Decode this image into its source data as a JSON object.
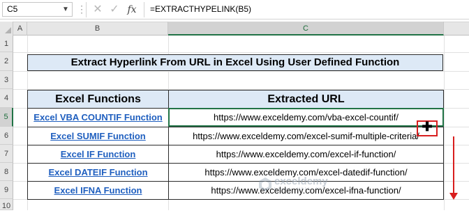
{
  "formula_bar": {
    "name_box": "C5",
    "formula": "=EXTRACTHYPELINK(B5)",
    "dropdown_icon": "chevron-down-icon",
    "cancel_icon": "close-icon",
    "enter_icon": "check-icon",
    "fx_icon": "fx"
  },
  "columns": [
    "A",
    "B",
    "C"
  ],
  "rows": [
    "1",
    "2",
    "3",
    "4",
    "5",
    "6",
    "7",
    "8",
    "9",
    "10"
  ],
  "active_cell": {
    "column": "C",
    "row": "5"
  },
  "title": "Extract Hyperlink From URL in Excel Using User Defined Function",
  "table": {
    "headers": [
      "Excel Functions",
      "Extracted URL"
    ],
    "rows": [
      {
        "function": "Excel VBA COUNTIF Function",
        "url": "https://www.exceldemy.com/vba-excel-countif/"
      },
      {
        "function": "Excel SUMIF Function",
        "url": "https://www.exceldemy.com/excel-sumif-multiple-criteria/"
      },
      {
        "function": "Excel IF Function",
        "url": "https://www.exceldemy.com/excel-if-function/"
      },
      {
        "function": "Excel DATEIF Function",
        "url": "https://www.exceldemy.com/excel-datedif-function/"
      },
      {
        "function": "Excel IFNA Function",
        "url": "https://www.exceldemy.com/excel-ifna-function/"
      }
    ]
  },
  "watermark": {
    "name": "exceldemy",
    "tagline": "EXCEL · DATA · BI"
  },
  "colors": {
    "header_fill": "#dde9f6",
    "link": "#1f5fbf",
    "selection": "#217346",
    "drag_indicator": "#d81e1e"
  }
}
